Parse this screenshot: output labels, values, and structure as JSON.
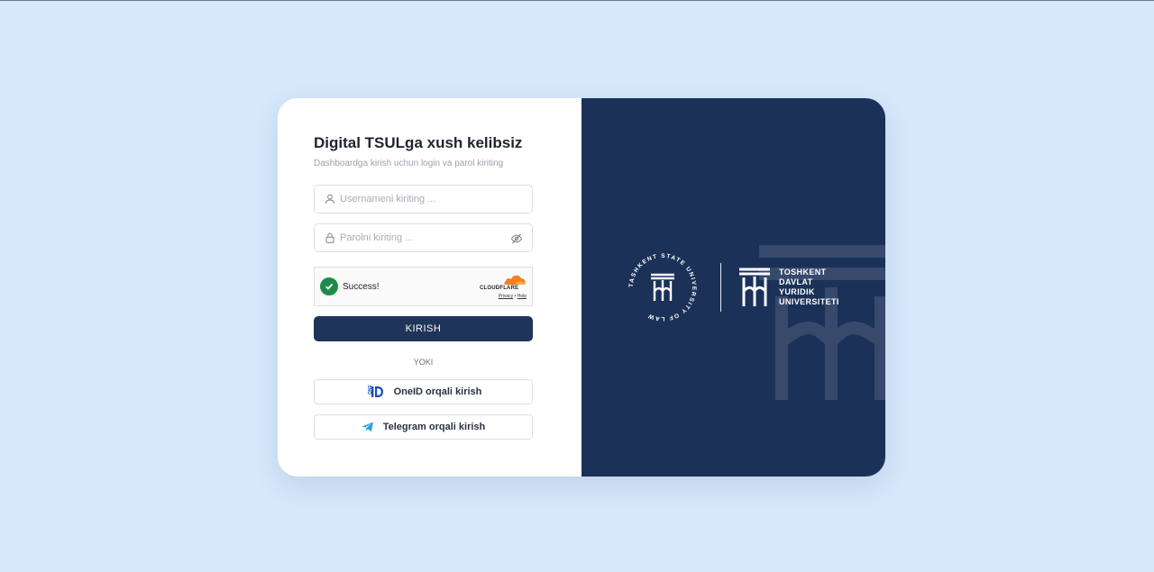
{
  "login": {
    "title": "Digital TSULga xush kelibsiz",
    "subtitle": "Dashboardga kirish uchun login va parol kiriting",
    "username_placeholder": "Usernameni kiriting ...",
    "password_placeholder": "Parolni kiriting ...",
    "captcha": {
      "status": "Success!",
      "brand": "CLOUDFLARE",
      "privacy": "Privacy",
      "separator": "•",
      "help": "Help"
    },
    "submit_label": "KIRISH",
    "divider_label": "YOKI",
    "oneid_label": "OneID orqali kirish",
    "telegram_label": "Telegram orqali kirish"
  },
  "branding": {
    "seal_text": "TASHKENT STATE UNIVERSITY OF LAW",
    "name_lines": [
      "TOSHKENT",
      "DAVLAT",
      "YURIDIK",
      "UNIVERSITETI"
    ]
  },
  "colors": {
    "background": "#d6e8fb",
    "panel": "#1b3158",
    "button": "#1f3459",
    "success": "#1e8b4a",
    "cloudflare": "#f48120",
    "oneid": "#1a4fb8",
    "telegram": "#2aa3df"
  },
  "icons": {
    "username": "user-icon",
    "password": "lock-icon",
    "toggle": "eye-off-icon",
    "captcha": "check-circle-icon",
    "oneid": "oneid-logo-icon",
    "telegram": "telegram-icon"
  }
}
